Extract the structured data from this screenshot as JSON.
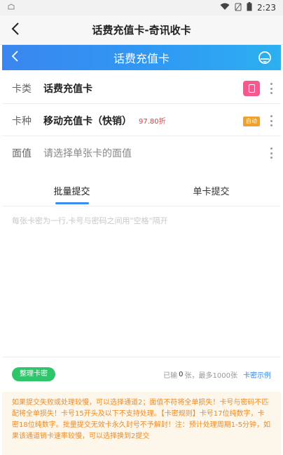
{
  "status_bar": {
    "time": "2:23"
  },
  "app_bar": {
    "title": "话费充值卡-奇讯收卡"
  },
  "web_bar": {
    "title": "话费充值卡"
  },
  "form": {
    "card_type": {
      "label": "卡类",
      "value": "话费充值卡"
    },
    "card_kind": {
      "label": "卡种",
      "value": "移动充值卡（快销）",
      "discount": "97.80折",
      "badge": "自动"
    },
    "face_value": {
      "label": "面值",
      "placeholder": "请选择单张卡的面值"
    }
  },
  "tabs": [
    {
      "label": "批量提交",
      "active": true
    },
    {
      "label": "单卡提交",
      "active": false
    }
  ],
  "input": {
    "placeholder": "每张卡密为一行,卡号与密码之间用\"空格\"隔开",
    "value": ""
  },
  "toolbar": {
    "organize_label": "整理卡密",
    "count_prefix": "已输",
    "count_value": "0",
    "count_suffix": "张，最多1000张",
    "example_label": "卡密示例"
  },
  "notice": {
    "text": "如果提交失败或处理较慢，可以选择通道2；面值不符将全单损失！卡号与密码不匹配将全单损失！卡号15开头及以下不支持处理。【卡密规则】卡号17位纯数字，卡密18位纯数字。批量提交无效卡永久封号不予解封！注：预计处理周期1-5分钟，如果该通道销卡速率较慢，可以选择换到2提交"
  },
  "colors": {
    "accent": "#3a8ef0",
    "green": "#2fc66b",
    "warning": "#f08a24",
    "discount": "#e0393e"
  }
}
